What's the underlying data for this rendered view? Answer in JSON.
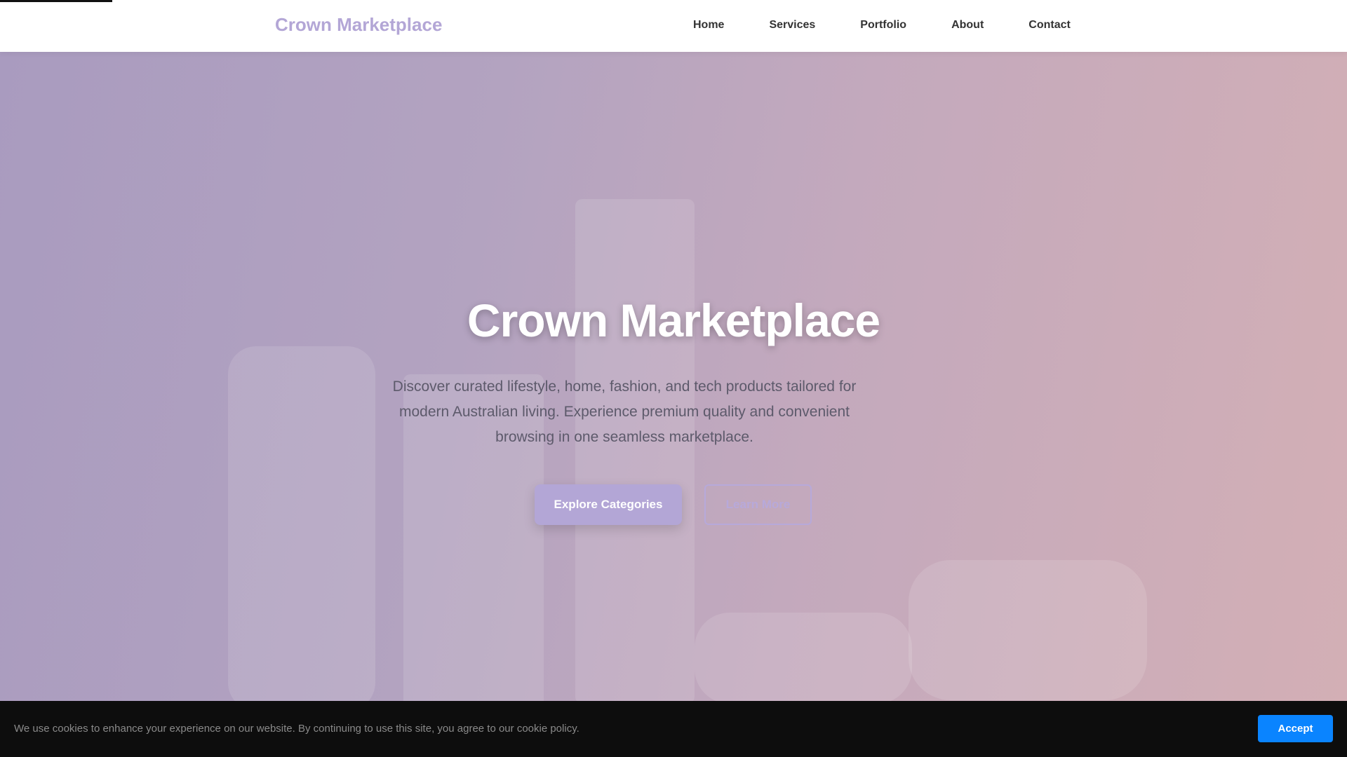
{
  "header": {
    "logo": "Crown Marketplace",
    "nav": [
      "Home",
      "Services",
      "Portfolio",
      "About",
      "Contact"
    ]
  },
  "hero": {
    "title": "Crown Marketplace",
    "description": "Discover curated lifestyle, home, fashion, and tech products tailored for modern Australian living. Experience premium quality and convenient browsing in one seamless marketplace.",
    "primary_button": "Explore Categories",
    "secondary_button": "Learn More"
  },
  "cookie": {
    "text": "We use cookies to enhance your experience on our website. By continuing to use this site, you agree to our cookie policy.",
    "accept": "Accept"
  },
  "colors": {
    "accent": "#b3a6d6",
    "accept": "#0a84ff"
  }
}
